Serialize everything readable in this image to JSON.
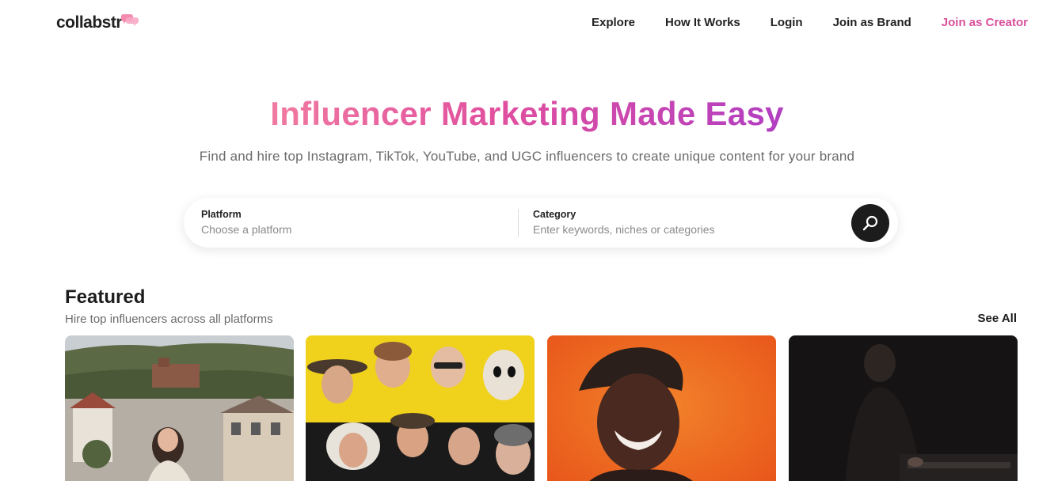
{
  "brand": {
    "name": "collabstr",
    "accent": "#d94f9c"
  },
  "nav": {
    "links": [
      {
        "label": "Explore"
      },
      {
        "label": "How It Works"
      },
      {
        "label": "Login"
      },
      {
        "label": "Join as Brand"
      },
      {
        "label": "Join as Creator"
      }
    ]
  },
  "hero": {
    "title": "Influencer Marketing Made Easy",
    "subtitle": "Find and hire top Instagram, TikTok, YouTube, and UGC influencers to create unique content for your brand"
  },
  "search": {
    "platform_label": "Platform",
    "platform_placeholder": "Choose a platform",
    "category_label": "Category",
    "category_placeholder": "Enter keywords, niches or categories",
    "button_icon": "search-icon"
  },
  "featured": {
    "title": "Featured",
    "subtitle": "Hire top influencers across all platforms",
    "see_all": "See All",
    "cards": [
      {
        "icon": "photo-woman-town"
      },
      {
        "icon": "photo-group-faces"
      },
      {
        "icon": "photo-woman-orange"
      },
      {
        "icon": "photo-man-piano"
      }
    ]
  }
}
